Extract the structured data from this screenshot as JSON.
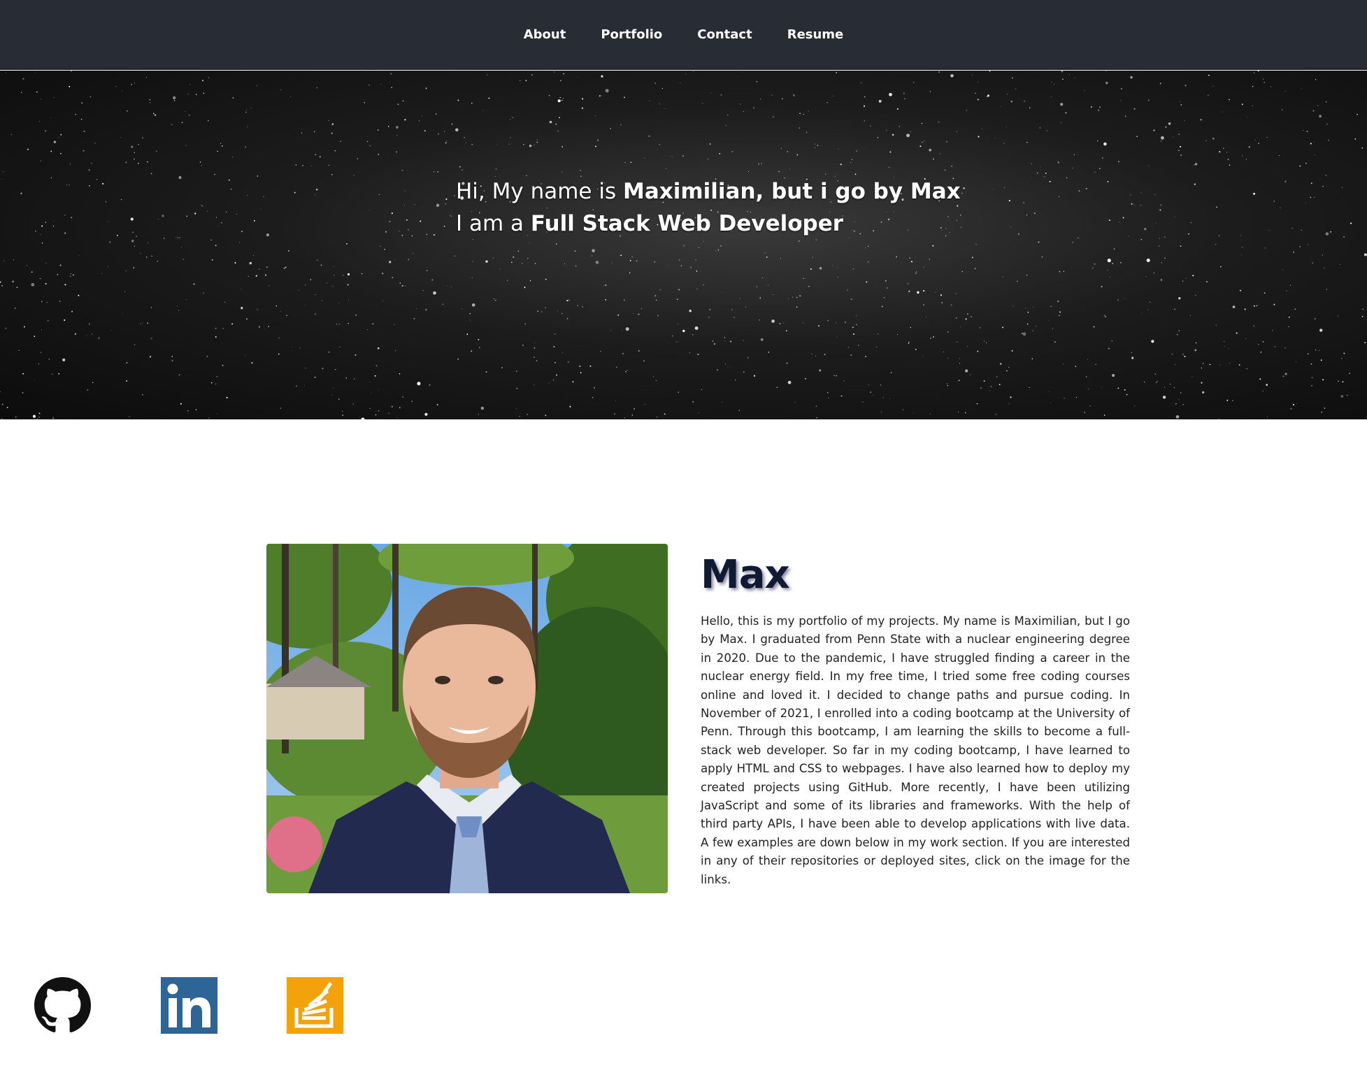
{
  "nav": {
    "items": [
      {
        "label": "About"
      },
      {
        "label": "Portfolio"
      },
      {
        "label": "Contact"
      },
      {
        "label": "Resume"
      }
    ]
  },
  "hero": {
    "line1_prefix": "Hi, My name is ",
    "line1_bold": "Maximilian, but i go by Max",
    "line2_prefix": "I am a ",
    "line2_bold": "Full Stack Web Developer"
  },
  "about": {
    "name": "Max",
    "bio": "Hello, this is my portfolio of my projects. My name is Maximilian, but I go by Max. I graduated from Penn State with a nuclear engineering degree in 2020. Due to the pandemic, I have struggled finding a career in the nuclear energy field. In my free time, I tried some free coding courses online and loved it. I decided to change paths and pursue coding. In November of 2021, I enrolled into a coding bootcamp at the University of Penn. Through this bootcamp, I am learning the skills to become a full-stack web developer. So far in my coding bootcamp, I have learned to apply HTML and CSS to webpages. I have also learned how to deploy my created projects using GitHub. More recently, I have been utilizing JavaScript and some of its libraries and frameworks. With the help of third party APIs, I have been able to develop applications with live data. A few examples are down below in my work section. If you are interested in any of their repositories or deployed sites, click on the image for the links."
  },
  "social": [
    {
      "icon": "github-icon"
    },
    {
      "icon": "linkedin-icon"
    },
    {
      "icon": "stackoverflow-icon"
    }
  ],
  "colors": {
    "nav_bg": "#282c34",
    "linkedin": "#2d6597",
    "stackoverflow": "#f4a20c"
  }
}
